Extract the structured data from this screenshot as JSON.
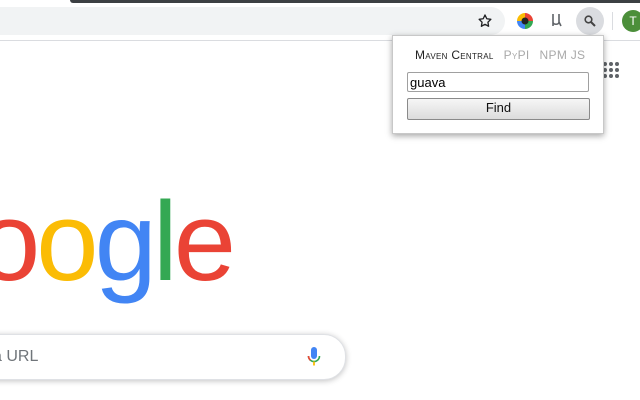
{
  "toolbar": {
    "avatar_letter": "T",
    "icons": [
      "star-icon",
      "color-wheel-icon",
      "mu-icon",
      "search-extension-icon"
    ]
  },
  "logo": {
    "letters": [
      {
        "char": "o",
        "color": "#ea4335"
      },
      {
        "char": "o",
        "color": "#fbbc05"
      },
      {
        "char": "g",
        "color": "#4285f4"
      },
      {
        "char": "l",
        "color": "#34a853"
      },
      {
        "char": "e",
        "color": "#ea4335"
      }
    ]
  },
  "search": {
    "placeholder_visible": "a URL"
  },
  "popup": {
    "tabs": [
      {
        "label": "Maven Central",
        "active": true
      },
      {
        "label": "PyPI",
        "active": false
      },
      {
        "label": "NPM JS",
        "active": false
      }
    ],
    "query_value": "guava",
    "find_label": "Find"
  },
  "colors": {
    "brand_red": "#ea4335",
    "brand_yellow": "#fbbc05",
    "brand_blue": "#4285f4",
    "brand_green": "#34a853",
    "avatar_bg": "#4c8f3a"
  }
}
